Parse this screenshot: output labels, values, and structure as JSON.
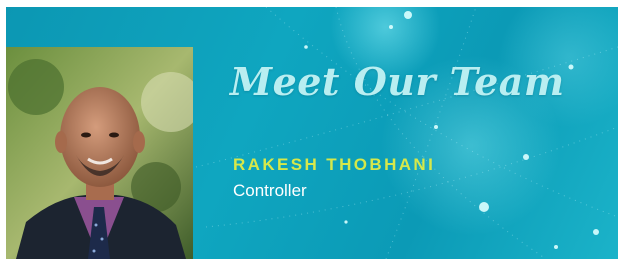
{
  "banner": {
    "heading": "Meet Our Team",
    "person_name": "RAKESH THOBHANI",
    "person_title": "Controller",
    "colors": {
      "background": "#0fa6c0",
      "heading": "#b9eef1",
      "name": "#d6e84a",
      "title": "#ffffff"
    },
    "photo_subject": "portrait-photo"
  }
}
